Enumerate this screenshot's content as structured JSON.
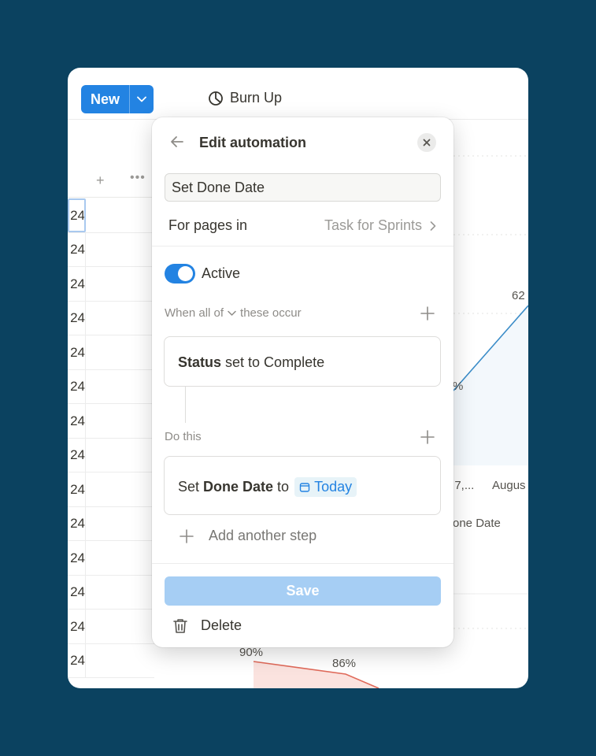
{
  "toolbar": {
    "new_label": "New",
    "view_name": "Burn Up"
  },
  "table": {
    "cells": [
      "24",
      "24",
      "24",
      "24",
      "24",
      "24",
      "24",
      "24",
      "24",
      "24",
      "24",
      "24",
      "24",
      "24"
    ]
  },
  "chart_background": {
    "top_label": "62",
    "partial_pct": "%",
    "x_ticks": [
      ": 7,...",
      "Augus"
    ],
    "legend": "one Date",
    "bottom_labels": [
      "90%",
      "86%"
    ]
  },
  "modal": {
    "title": "Edit automation",
    "name_value": "Set Done Date",
    "for_pages_label": "For pages in",
    "database_name": "Task for Sprints",
    "active_label": "Active",
    "when_prefix": "When all of",
    "when_suffix": "these occur",
    "trigger": {
      "property": "Status",
      "rest": "set to Complete"
    },
    "do_this_label": "Do this",
    "action": {
      "prefix": "Set",
      "property": "Done Date",
      "to": "to",
      "value": "Today"
    },
    "add_step_label": "Add another step",
    "save_label": "Save",
    "delete_label": "Delete"
  },
  "colors": {
    "background": "#0b4260",
    "accent": "#2383e2",
    "save_disabled": "#a6cef4",
    "burnup_line": "#3a8cc8",
    "burndown_line": "#e06a5a"
  }
}
